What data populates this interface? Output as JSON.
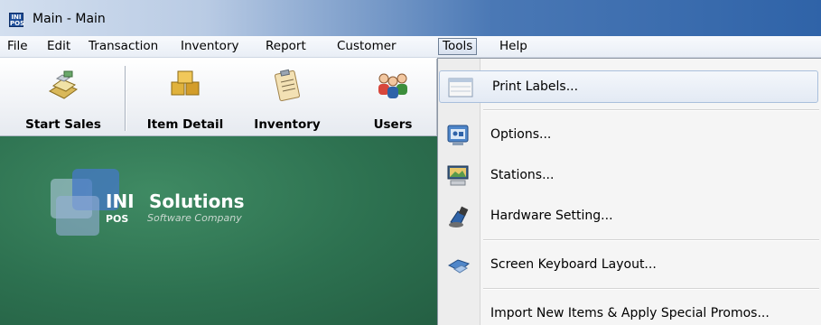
{
  "window": {
    "title": "Main - Main",
    "icon": "ini-pos-app-icon"
  },
  "menu": {
    "items": [
      {
        "label": "File"
      },
      {
        "label": "Edit"
      },
      {
        "label": "Transaction"
      },
      {
        "label": "Inventory"
      },
      {
        "label": "Report"
      },
      {
        "label": "Customer"
      },
      {
        "label": "Tools",
        "active": true
      },
      {
        "label": "Help"
      }
    ]
  },
  "toolbar": {
    "buttons": [
      {
        "label": "Start Sales",
        "icon": "cash-register-icon"
      },
      {
        "label": "Item Detail",
        "icon": "boxes-icon"
      },
      {
        "label": "Inventory",
        "icon": "clipboard-icon"
      },
      {
        "label": "Users",
        "icon": "users-icon"
      }
    ]
  },
  "logo": {
    "mark": "INI",
    "sub_mark": "POS",
    "name": "Solutions",
    "tagline": "Software Company"
  },
  "tools_menu": {
    "items": [
      {
        "label": "Print Labels...",
        "icon": "label-sheet-icon",
        "hovered": true
      },
      {
        "label": "Options...",
        "icon": "options-window-icon"
      },
      {
        "label": "Stations...",
        "icon": "station-computer-icon"
      },
      {
        "label": "Hardware Setting...",
        "icon": "hardware-icon"
      },
      {
        "label": "Screen Keyboard Layout...",
        "icon": "keyboard-icon"
      },
      {
        "label": "Import New Items & Apply Special Promos...",
        "icon": ""
      }
    ]
  },
  "colors": {
    "accent": "#2f63a8",
    "desktop_green": "#2d7150"
  }
}
